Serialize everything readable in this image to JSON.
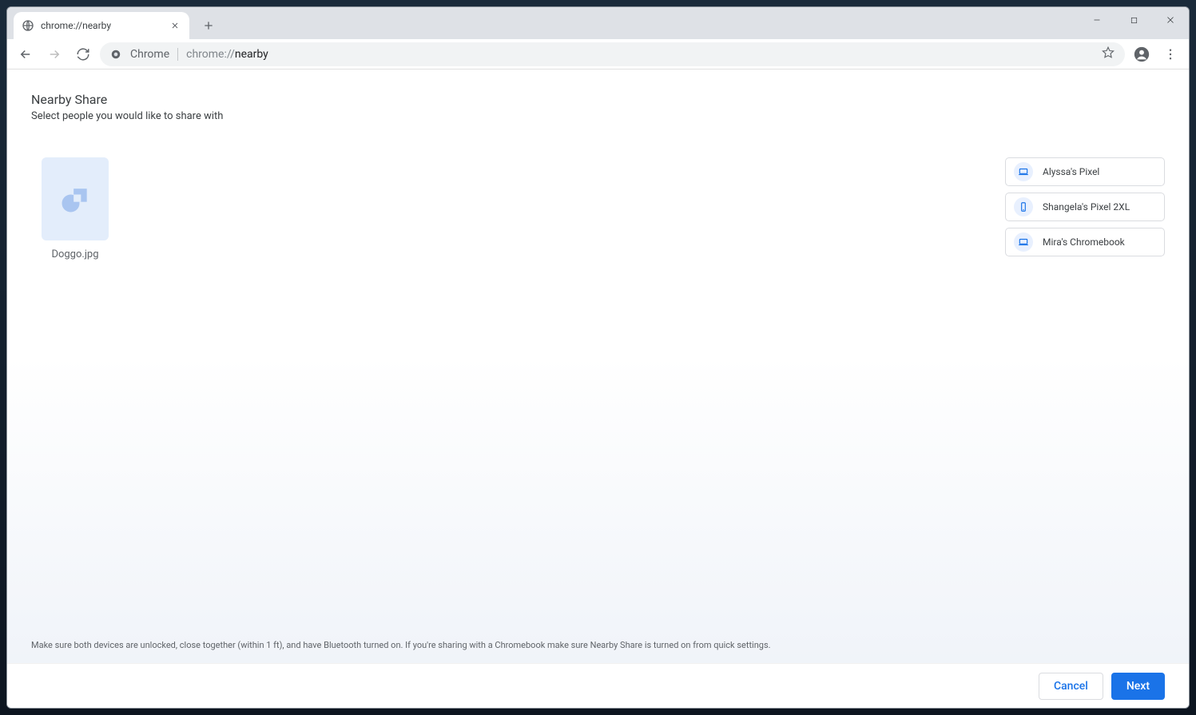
{
  "window": {
    "tab_title": "chrome://nearby"
  },
  "omnibox": {
    "chrome_label": "Chrome",
    "url_prefix": "chrome://",
    "url_path": "nearby"
  },
  "page": {
    "title": "Nearby Share",
    "subtitle": "Select people you would like to share with",
    "helper": "Make sure both devices are unlocked, close together (within 1 ft), and have Bluetooth turned on. If you're sharing with a Chromebook make sure Nearby Share is turned on from quick settings."
  },
  "file": {
    "name": "Doggo.jpg"
  },
  "devices": [
    {
      "label": "Alyssa's Pixel",
      "icon": "laptop"
    },
    {
      "label": "Shangela's Pixel 2XL",
      "icon": "phone"
    },
    {
      "label": "Mira's Chromebook",
      "icon": "laptop"
    }
  ],
  "footer": {
    "cancel": "Cancel",
    "next": "Next"
  }
}
